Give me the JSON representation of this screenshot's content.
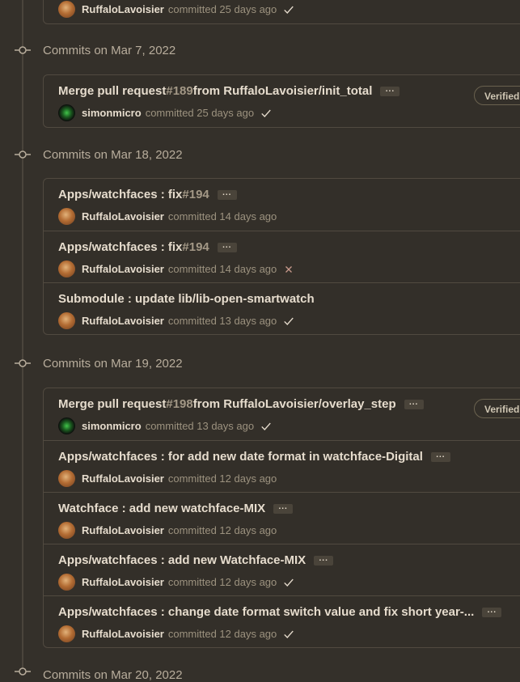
{
  "top": {
    "author": "RuffaloLavoisier",
    "action": "committed 25 days ago",
    "status": "success"
  },
  "groups": [
    {
      "title": "Commits on Mar 7, 2022",
      "commits": [
        {
          "message": "Merge pull request ",
          "pr": "#189",
          "message_tail": " from RuffaloLavoisier/init_total",
          "author": "simonmicro",
          "action": "committed 25 days ago",
          "status": "success",
          "verified": "Verified"
        }
      ]
    },
    {
      "title": "Commits on Mar 18, 2022",
      "commits": [
        {
          "message": "Apps/watchfaces : fix ",
          "pr": "#194",
          "author": "RuffaloLavoisier",
          "action": "committed 14 days ago"
        },
        {
          "message": "Apps/watchfaces : fix ",
          "pr": "#194",
          "author": "RuffaloLavoisier",
          "action": "committed 14 days ago",
          "status": "failure"
        },
        {
          "message": "Submodule : update lib/lib-open-smartwatch",
          "author": "RuffaloLavoisier",
          "action": "committed 13 days ago",
          "status": "success"
        }
      ]
    },
    {
      "title": "Commits on Mar 19, 2022",
      "commits": [
        {
          "message": "Merge pull request ",
          "pr": "#198",
          "message_tail": " from RuffaloLavoisier/overlay_step",
          "author": "simonmicro",
          "action": "committed 13 days ago",
          "status": "success",
          "verified": "Verified"
        },
        {
          "message": "Apps/watchfaces : for add new date format in watchface-Digital",
          "author": "RuffaloLavoisier",
          "action": "committed 12 days ago"
        },
        {
          "message": "Watchface : add new watchface-MIX",
          "author": "RuffaloLavoisier",
          "action": "committed 12 days ago"
        },
        {
          "message": "Apps/watchfaces : add new Watchface-MIX",
          "author": "RuffaloLavoisier",
          "action": "committed 12 days ago",
          "status": "success"
        },
        {
          "message": "Apps/watchfaces : change date format switch value and fix short year-...",
          "author": "RuffaloLavoisier",
          "action": "committed 12 days ago",
          "status": "success"
        }
      ]
    }
  ],
  "bottom_partial_title": "Commits on Mar 20, 2022",
  "colors": {
    "background": "#34302a",
    "border": "#514a40",
    "success": "#e6dccd",
    "failure": "#c99a8c"
  }
}
